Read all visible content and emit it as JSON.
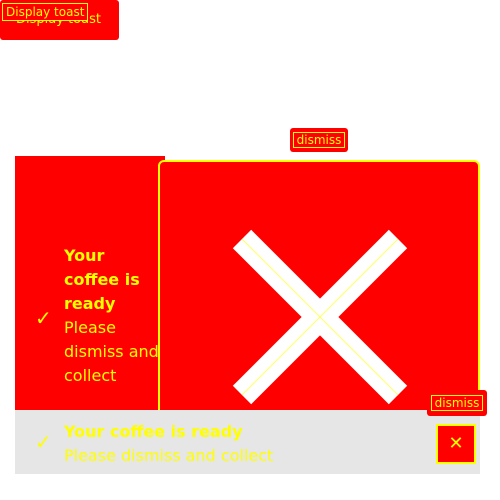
{
  "display_button": {
    "label": "Display toast",
    "tooltip": "Display toast"
  },
  "toast": {
    "icon": "checkmark-icon",
    "title": "Your coffee is ready",
    "message": "Please dismiss and collect"
  },
  "dismiss": {
    "label": "dismiss",
    "icon": "close-icon"
  },
  "colors": {
    "highlight": "#ff0000",
    "text": "#ffff00",
    "toast_background": "#e6e6e6"
  }
}
